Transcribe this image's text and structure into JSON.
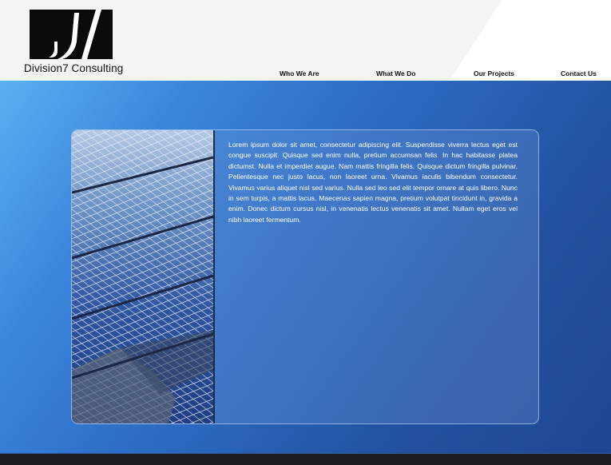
{
  "brand": {
    "name": "Division7 Consulting",
    "logo_icon": "division7-logo-icon"
  },
  "nav": {
    "items": [
      {
        "label": "Who We Are"
      },
      {
        "label": "What We Do"
      },
      {
        "label": "Our Projects"
      },
      {
        "label": "Contact Us"
      }
    ]
  },
  "content": {
    "image_alt": "solar-panels-photo",
    "body": "Lorem ipsum dolor sit amet, consectetur adipiscing elit. Suspendisse viverra lectus eget est congue suscipit. Quisque sed enim nulla, pretium accumsan felis. In hac habitasse platea dictumst. Nulla et imperdiet augue. Nam mattis fringilla felis. Quisque dictum fringilla pulvinar. Pellentesque nec justo lacus, non laoreet urna. Vivamus iaculis bibendum consectetur. Vivamus varius aliquet nisl sed varius. Nulla sed leo sed elit tempor ornare at quis libero. Nunc in sem turpis, a mattis lacus. Maecenas sapien magna, pretium volutpat tincidunt in, gravida a enim. Donec dictum cursus nisl, in venenatis lectus venenatis sit amet. Nullam eget eros vel nibh laoreet fermentum."
  },
  "colors": {
    "header_bg": "#f4f4f4",
    "main_gradient_start": "#5ab0f2",
    "main_gradient_end": "#1d4791",
    "footer_bg": "#1b1d22",
    "text_light": "#ffffff",
    "text_dark": "#111111"
  }
}
